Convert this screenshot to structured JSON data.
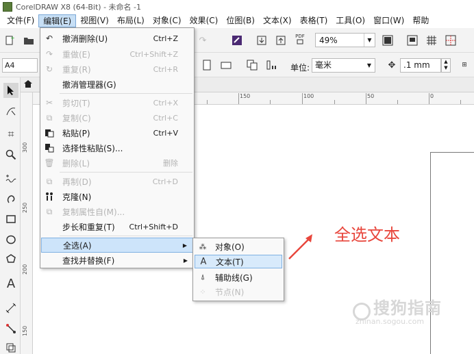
{
  "window": {
    "title": "CorelDRAW X8 (64-Bit) - 未命名 -1"
  },
  "menubar": [
    {
      "label": "文件(F)"
    },
    {
      "label": "编辑(E)"
    },
    {
      "label": "视图(V)"
    },
    {
      "label": "布局(L)"
    },
    {
      "label": "对象(C)"
    },
    {
      "label": "效果(C)"
    },
    {
      "label": "位图(B)"
    },
    {
      "label": "文本(X)"
    },
    {
      "label": "表格(T)"
    },
    {
      "label": "工具(O)"
    },
    {
      "label": "窗口(W)"
    },
    {
      "label": "帮助"
    }
  ],
  "toolbar": {
    "zoom": "49%",
    "page_size": "A4",
    "unit_label": "单位:",
    "unit_value": "毫米",
    "nudge": ".1 mm",
    "pdf_label": "PDF"
  },
  "ruler": {
    "h_labels": [
      "150",
      "100",
      "50",
      "0"
    ],
    "v_labels": [
      "300",
      "250",
      "200",
      "150"
    ]
  },
  "edit_menu": {
    "items": [
      {
        "label": "撤消删除(U)",
        "shortcut": "Ctrl+Z",
        "icon": "undo-icon",
        "enabled": true
      },
      {
        "label": "重做(E)",
        "shortcut": "Ctrl+Shift+Z",
        "icon": "redo-icon",
        "enabled": false
      },
      {
        "label": "重复(R)",
        "shortcut": "Ctrl+R",
        "icon": "repeat-icon",
        "enabled": false
      },
      {
        "label": "撤消管理器(G)",
        "shortcut": "",
        "icon": "",
        "enabled": true
      },
      {
        "label": "剪切(T)",
        "shortcut": "Ctrl+X",
        "icon": "cut-icon",
        "enabled": false
      },
      {
        "label": "复制(C)",
        "shortcut": "Ctrl+C",
        "icon": "copy-icon",
        "enabled": false
      },
      {
        "label": "粘贴(P)",
        "shortcut": "Ctrl+V",
        "icon": "paste-icon",
        "enabled": true
      },
      {
        "label": "选择性粘贴(S)...",
        "shortcut": "",
        "icon": "paste-special-icon",
        "enabled": true
      },
      {
        "label": "删除(L)",
        "shortcut": "删除",
        "icon": "delete-icon",
        "enabled": false
      },
      {
        "label": "再制(D)",
        "shortcut": "Ctrl+D",
        "icon": "duplicate-icon",
        "enabled": false
      },
      {
        "label": "克隆(N)",
        "shortcut": "",
        "icon": "clone-icon",
        "enabled": true
      },
      {
        "label": "复制属性自(M)...",
        "shortcut": "",
        "icon": "copy-properties-icon",
        "enabled": false
      },
      {
        "label": "步长和重复(T)",
        "shortcut": "Ctrl+Shift+D",
        "icon": "",
        "enabled": true
      },
      {
        "label": "全选(A)",
        "shortcut": "",
        "icon": "",
        "enabled": true,
        "submenu": true
      },
      {
        "label": "查找并替换(F)",
        "shortcut": "",
        "icon": "",
        "enabled": true,
        "submenu": true
      }
    ]
  },
  "select_all_submenu": {
    "items": [
      {
        "label": "对象(O)",
        "icon": "objects-icon",
        "enabled": true
      },
      {
        "label": "文本(T)",
        "icon": "text-icon",
        "enabled": true
      },
      {
        "label": "辅助线(G)",
        "icon": "guidelines-icon",
        "enabled": true
      },
      {
        "label": "节点(N)",
        "icon": "nodes-icon",
        "enabled": false
      }
    ]
  },
  "annotation": {
    "text": "全选文本",
    "color": "#e8463c"
  },
  "watermark": {
    "main": "搜狗指南",
    "sub": "zhinan.sogou.com"
  },
  "colors": {
    "highlight": "#cde4fa",
    "highlight_border": "#7fb0e2",
    "accent_red": "#e8463c"
  }
}
